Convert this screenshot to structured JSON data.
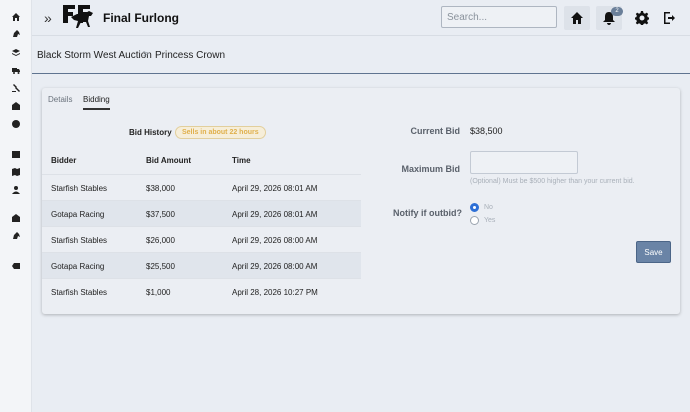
{
  "app": {
    "title": "Final Furlong",
    "expand_icon": "double-chevron-right-icon"
  },
  "search": {
    "placeholder": "Search..."
  },
  "notifications": {
    "count": "2"
  },
  "breadcrumb": {
    "items": [
      "Black Storm West Auction",
      "Princess Crown"
    ],
    "separator": ">"
  },
  "tabs": [
    {
      "label": "Details",
      "active": false
    },
    {
      "label": "Bidding",
      "active": true
    }
  ],
  "bid_history": {
    "label": "Bid History",
    "badge": "Sells in about 22 hours",
    "columns": [
      "Bidder",
      "Bid Amount",
      "Time"
    ],
    "rows": [
      {
        "bidder": "Starfish Stables",
        "amount": "$38,000",
        "time": "April 29, 2026 08:01 AM"
      },
      {
        "bidder": "Gotapa Racing",
        "amount": "$37,500",
        "time": "April 29, 2026 08:01 AM"
      },
      {
        "bidder": "Starfish Stables",
        "amount": "$26,000",
        "time": "April 29, 2026 08:00 AM"
      },
      {
        "bidder": "Gotapa Racing",
        "amount": "$25,500",
        "time": "April 29, 2026 08:00 AM"
      },
      {
        "bidder": "Starfish Stables",
        "amount": "$1,000",
        "time": "April 28, 2026 10:27 PM"
      }
    ]
  },
  "bidding_form": {
    "current_bid_label": "Current Bid",
    "current_bid_value": "$38,500",
    "max_bid_label": "Maximum Bid",
    "max_bid_value": "",
    "max_bid_hint": "(Optional) Must be $500 higher than your current bid.",
    "notify_label": "Notify if outbid?",
    "notify_options": [
      {
        "label": "No",
        "selected": true
      },
      {
        "label": "Yes",
        "selected": false
      }
    ],
    "save_label": "Save"
  },
  "colors": {
    "accent": "#6a84a6",
    "badge_text": "#e0b04c",
    "radio_on": "#2d6fd6"
  }
}
